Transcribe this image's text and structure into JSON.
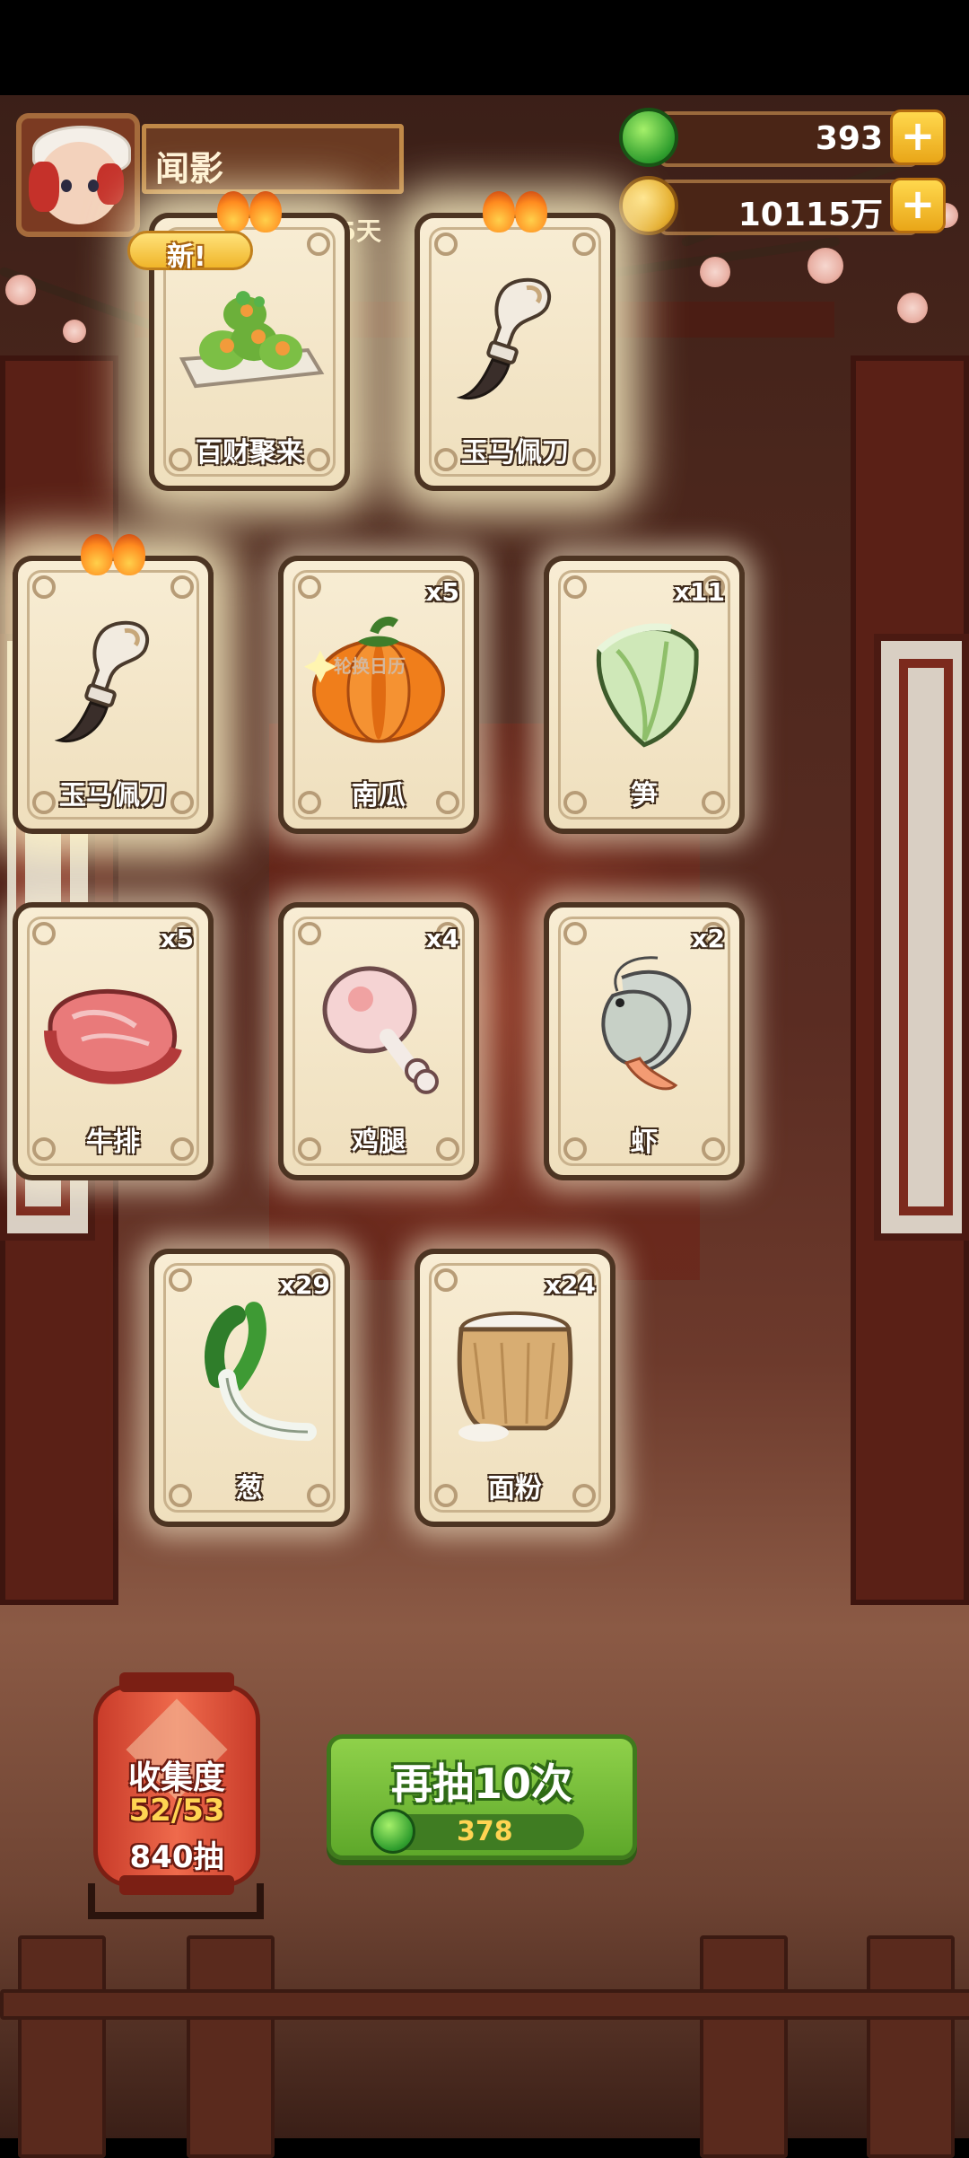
{
  "player": {
    "name": "闻影",
    "days": "15天"
  },
  "currency": {
    "jade": "393",
    "coins": "10115万"
  },
  "calendar_label": "轮换日历",
  "new_badge": "新!",
  "cards": [
    {
      "name": "百财聚来",
      "qty": "",
      "icon": "cabbage-dish-icon",
      "rare": true,
      "is_new": true
    },
    {
      "name": "玉马佩刀",
      "qty": "",
      "icon": "jade-knife-icon",
      "rare": true
    },
    {
      "name": "玉马佩刀",
      "qty": "",
      "icon": "jade-knife-icon",
      "rare": true
    },
    {
      "name": "南瓜",
      "qty": "x5",
      "icon": "pumpkin-icon"
    },
    {
      "name": "笋",
      "qty": "x11",
      "icon": "bamboo-shoot-icon"
    },
    {
      "name": "牛排",
      "qty": "x5",
      "icon": "steak-icon"
    },
    {
      "name": "鸡腿",
      "qty": "x4",
      "icon": "chicken-leg-icon"
    },
    {
      "name": "虾",
      "qty": "x2",
      "icon": "shrimp-icon"
    },
    {
      "name": "葱",
      "qty": "x29",
      "icon": "scallion-icon"
    },
    {
      "name": "面粉",
      "qty": "x24",
      "icon": "flour-sack-icon"
    }
  ],
  "collection": {
    "label": "收集度",
    "progress": "52/53",
    "draws": "840抽"
  },
  "draw_button": {
    "label": "再抽10次",
    "cost": "378"
  },
  "colors": {
    "accent_green": "#5ea82a",
    "card_bg": "#f8edd4",
    "gold": "#ffd452"
  }
}
